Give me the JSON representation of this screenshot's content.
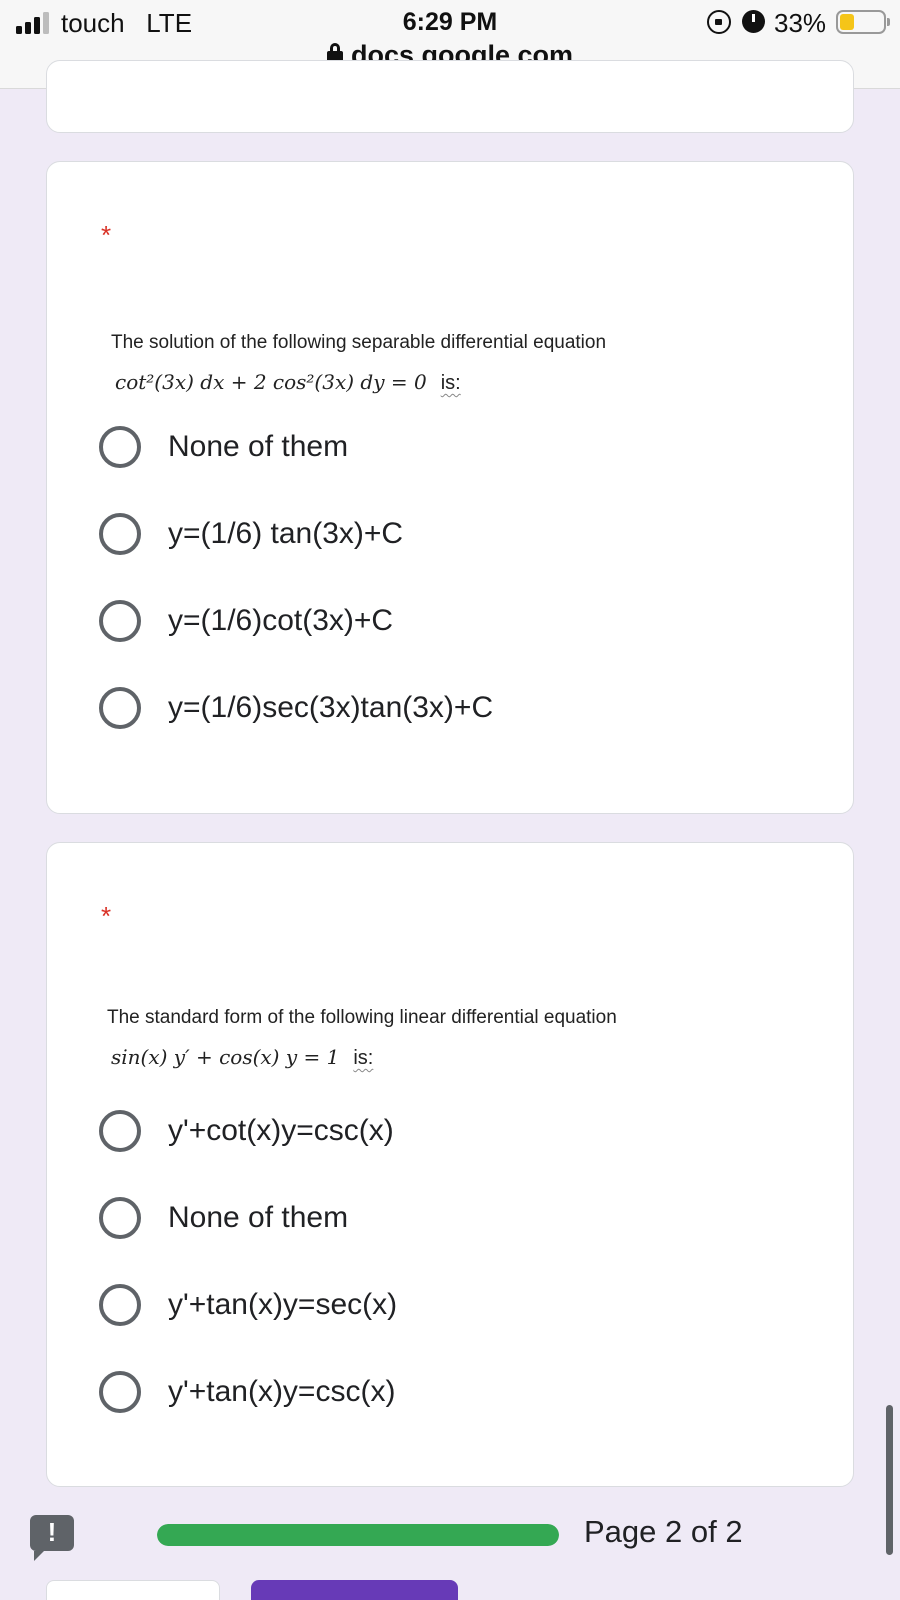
{
  "status_bar": {
    "carrier": "touch",
    "network": "LTE",
    "time": "6:29 PM",
    "url": "docs.google.com",
    "battery_percent": "33%",
    "battery_level": 0.33,
    "icons": [
      "signal-icon",
      "lock-icon",
      "rotation-lock-icon",
      "alarm-icon",
      "battery-icon"
    ]
  },
  "questions": [
    {
      "required_mark": "*",
      "text": "The solution of the following separable differential equation",
      "equation": "cot²(3x) dx + 2 cos²(3x) dy = 0",
      "equation_suffix": "is:",
      "options": [
        "None of them",
        "y=(1/6) tan(3x)+C",
        "y=(1/6)cot(3x)+C",
        "y=(1/6)sec(3x)tan(3x)+C"
      ]
    },
    {
      "required_mark": "*",
      "text": "The standard form of the following linear differential equation",
      "equation": "sin(x) y′ + cos(x) y = 1",
      "equation_suffix": "is:",
      "options": [
        "y'+cot(x)y=csc(x)",
        "None of them",
        "y'+tan(x)y=sec(x)",
        "y'+tan(x)y=csc(x)"
      ]
    }
  ],
  "footer": {
    "report_icon_glyph": "!",
    "progress": 1.0,
    "progress_color": "#34a853",
    "page_indicator": "Page 2 of 2",
    "submit_color": "#673ab7"
  }
}
